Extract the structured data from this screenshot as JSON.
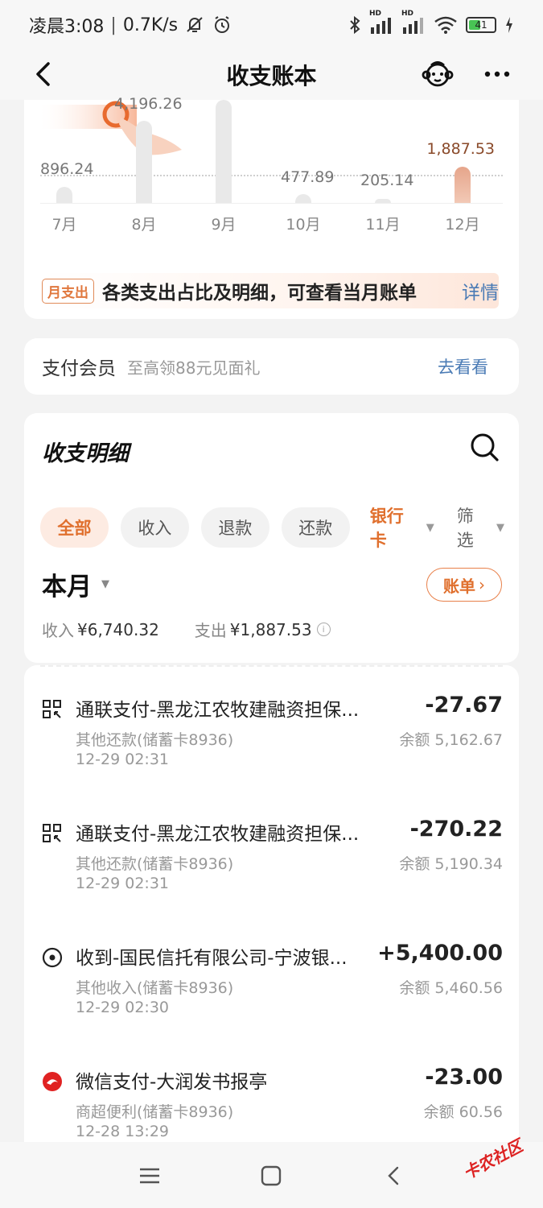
{
  "status_bar": {
    "time": "凌晨3:08",
    "speed": "0.7K/s",
    "signal1": "HD",
    "signal2": "HD",
    "battery": "41"
  },
  "nav": {
    "title": "收支账本"
  },
  "chart_data": {
    "type": "bar",
    "categories": [
      "7月",
      "8月",
      "9月",
      "10月",
      "11月",
      "12月"
    ],
    "values": [
      896.24,
      4196.26,
      null,
      477.89,
      205.14,
      1887.53
    ],
    "value_labels": [
      "896.24",
      "4,196.26",
      "",
      "477.89",
      "205.14",
      "1,887.53"
    ],
    "highlight_index": 5,
    "colors": {
      "bar": "#e9e9e9",
      "highlight": "#e6a58b"
    }
  },
  "tip": {
    "badge": "月支出",
    "text": "各类支出占比及明细，可查看当月账单",
    "link": "详情"
  },
  "member": {
    "title": "支付会员",
    "subtitle": "至高领88元见面礼",
    "link": "去看看"
  },
  "details": {
    "title": "收支明细",
    "chips": [
      "全部",
      "收入",
      "退款",
      "还款"
    ],
    "bank_dropdown": "银行卡",
    "filter_dropdown": "筛选",
    "month": "本月",
    "bill_button": "账单",
    "income_label": "收入",
    "income_value": "¥6,740.32",
    "expense_label": "支出",
    "expense_value": "¥1,887.53"
  },
  "transactions": [
    {
      "icon": "qr-pay-icon",
      "name": "通联支付-黑龙江农牧建融资担保...",
      "category": "其他还款(储蓄卡8936)",
      "time": "12-29 02:31",
      "amount": "-27.67",
      "balance": "余额 5,162.67"
    },
    {
      "icon": "qr-pay-icon",
      "name": "通联支付-黑龙江农牧建融资担保...",
      "category": "其他还款(储蓄卡8936)",
      "time": "12-29 02:31",
      "amount": "-270.22",
      "balance": "余额 5,190.34"
    },
    {
      "icon": "income-dot-icon",
      "name": "收到-国民信托有限公司-宁波银...",
      "category": "其他收入(储蓄卡8936)",
      "time": "12-29 02:30",
      "amount": "+5,400.00",
      "balance": "余额 5,460.56"
    },
    {
      "icon": "merchant-logo-icon",
      "name": "微信支付-大润发书报亭",
      "category": "商超便利(储蓄卡8936)",
      "time": "12-28 13:29",
      "amount": "-23.00",
      "balance": "余额 60.56"
    }
  ],
  "watermark": "卡农社区"
}
